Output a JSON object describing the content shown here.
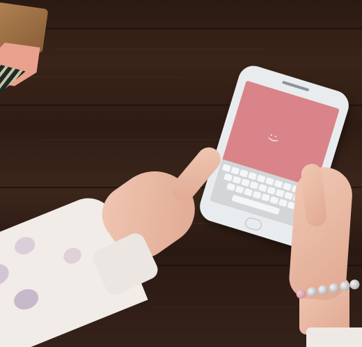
{
  "scene": {
    "description_tag": "",
    "screen_face": ":)",
    "colors": {
      "table": "#3a2419",
      "screen": "#d98488",
      "phone": "#e9ecee",
      "coaster_pink": "#e9a08c",
      "sleeve": "#f1ece8"
    }
  }
}
